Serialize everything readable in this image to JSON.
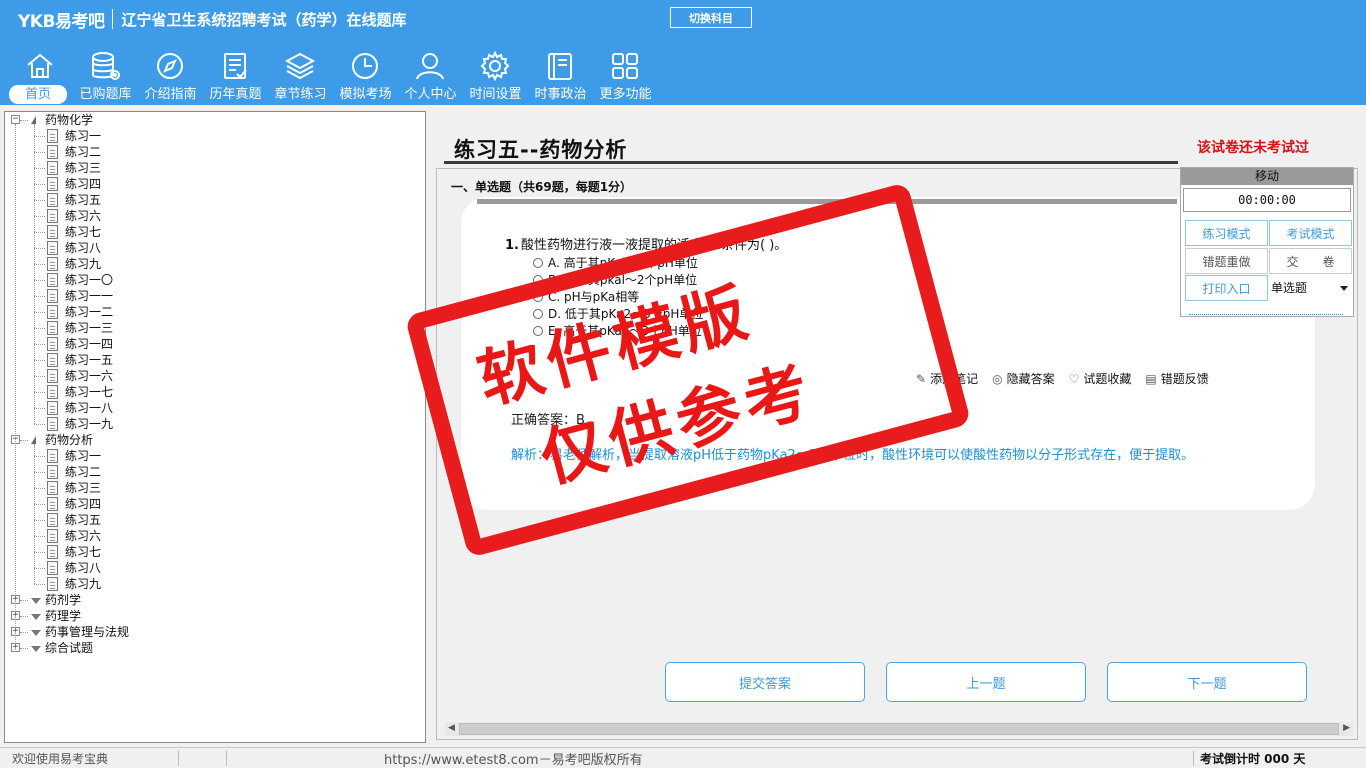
{
  "header": {
    "logo": "YKB易考吧",
    "title": "辽宁省卫生系统招聘考试（药学）在线题库",
    "switch_subject": "切换科目",
    "nav": [
      {
        "label": "首页",
        "icon": "home-icon"
      },
      {
        "label": "已购题库",
        "icon": "database-icon"
      },
      {
        "label": "介绍指南",
        "icon": "compass-icon"
      },
      {
        "label": "历年真题",
        "icon": "checklist-icon"
      },
      {
        "label": "章节练习",
        "icon": "layers-icon"
      },
      {
        "label": "模拟考场",
        "icon": "clock-icon"
      },
      {
        "label": "个人中心",
        "icon": "user-icon"
      },
      {
        "label": "时间设置",
        "icon": "gear-icon"
      },
      {
        "label": "时事政治",
        "icon": "news-icon"
      },
      {
        "label": "更多功能",
        "icon": "grid-icon"
      }
    ]
  },
  "tree": {
    "groups": [
      {
        "label": "药物化学",
        "expanded": true,
        "items": [
          "练习一",
          "练习二",
          "练习三",
          "练习四",
          "练习五",
          "练习六",
          "练习七",
          "练习八",
          "练习九",
          "练习一〇",
          "练习一一",
          "练习一二",
          "练习一三",
          "练习一四",
          "练习一五",
          "练习一六",
          "练习一七",
          "练习一八",
          "练习一九"
        ]
      },
      {
        "label": "药物分析",
        "expanded": true,
        "items": [
          "练习一",
          "练习二",
          "练习三",
          "练习四",
          "练习五",
          "练习六",
          "练习七",
          "练习八",
          "练习九"
        ]
      },
      {
        "label": "药剂学",
        "expanded": false,
        "items": []
      },
      {
        "label": "药理学",
        "expanded": false,
        "items": []
      },
      {
        "label": "药事管理与法规",
        "expanded": false,
        "items": []
      },
      {
        "label": "综合试题",
        "expanded": false,
        "items": []
      }
    ]
  },
  "main": {
    "doc_title": "练习五--药物分析",
    "exam_status": "该试卷还未考试过",
    "section_title": "一、单选题（共69题，每题1分）",
    "question": {
      "number": "1.",
      "stem": "酸性药物进行液一液提取的适宜pH条件为( )。",
      "options": [
        "A. 高于其pKal～2个pH单位",
        "B. 低于其pkal～2个pH单位",
        "C. pH与pKa相等",
        "D. 低于其pKa2～3个pH单位",
        "E. 高于其pKa2～3个pH单位"
      ]
    },
    "tools": [
      {
        "label": "添加笔记",
        "icon": "pencil-icon"
      },
      {
        "label": "隐藏答案",
        "icon": "eye-icon"
      },
      {
        "label": "试题收藏",
        "icon": "heart-icon"
      },
      {
        "label": "错题反馈",
        "icon": "feedback-icon"
      }
    ],
    "answer_line": "正确答案：B",
    "analysis": "解析：易老师解析，当提取溶液pH低于药物pKa2～3个单位时，酸性环境可以使酸性药物以分子形式存在，便于提取。",
    "buttons": {
      "submit": "提交答案",
      "prev": "上一题",
      "next": "下一题"
    }
  },
  "control_panel": {
    "header": "移动",
    "timer": "00:00:00",
    "practice_mode": "练习模式",
    "exam_mode": "考试模式",
    "redo_wrong": "错题重做",
    "submit_paper": "交　　卷",
    "print": "打印入口",
    "question_type": "单选题"
  },
  "watermark": {
    "line1": "软件模版",
    "line2": "仅供参考"
  },
  "statusbar": {
    "welcome": "欢迎使用易考宝典",
    "url": "https://www.etest8.com－易考吧版权所有",
    "countdown": "考试倒计时 000 天"
  },
  "colors": {
    "header_bg": "#3d9be8",
    "accent": "#3a9be0",
    "status_red": "#d11111",
    "stamp_red": "#e81c1c",
    "analysis_blue": "#1c8ed8"
  }
}
